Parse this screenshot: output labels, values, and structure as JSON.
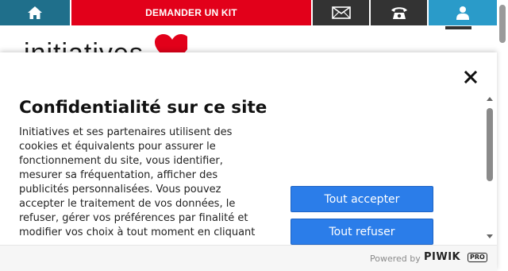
{
  "topbar": {
    "home_icon": "home-icon",
    "kit_label": "DEMANDER UN KIT",
    "mail_icon": "envelope-icon",
    "phone_icon": "phone-icon",
    "user_icon": "user-icon"
  },
  "header": {
    "logo_text": "initiatives",
    "menu_icon": "hamburger-icon"
  },
  "consent": {
    "title": "Confidentialité sur ce site",
    "body": "Initiatives et ses partenaires utilisent des cookies et équivalents pour assurer le fonctionnement du site, vous identifier, mesurer sa fréquentation, afficher des publicités personnalisées. Vous pouvez accepter le traitement de vos données, le refuser, gérer vos préférences par finalité et modifier vos choix à tout moment en cliquant",
    "accept_label": "Tout accepter",
    "refuse_label": "Tout refuser",
    "close_icon": "close-icon",
    "powered_by": "Powered by",
    "brand": "PIWIK",
    "brand_badge": "PRO"
  },
  "colors": {
    "home": "#1f6f8b",
    "kit": "#e2001a",
    "dark": "#333333",
    "user": "#2a9bc9",
    "button": "#2b7de9"
  }
}
